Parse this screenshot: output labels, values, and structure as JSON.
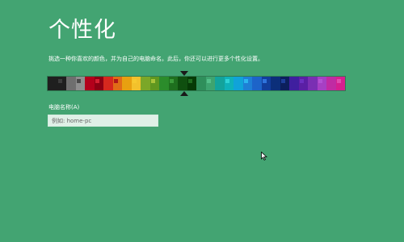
{
  "page": {
    "title": "个性化",
    "instruction": "挑选一种你喜欢的颜色，并为自己的电脑命名。此后，你还可以进行更多个性化设置。"
  },
  "colors": {
    "background": "#43a472",
    "text": "#ffffff"
  },
  "palette": {
    "selected_index": 8,
    "swatches": [
      {
        "left": "#1f1f1f",
        "right": "#1f1f1f",
        "chip": "#3c3c3c"
      },
      {
        "left": "#6f6f6f",
        "right": "#8f8f8f",
        "chip": "#4a4a4a"
      },
      {
        "left": "#b3001b",
        "right": "#8d0013",
        "chip": "#d41f32"
      },
      {
        "left": "#d5281e",
        "right": "#e06c17",
        "chip": "#b01618"
      },
      {
        "left": "#e8a010",
        "right": "#f3c12c",
        "chip": "#f7c92f"
      },
      {
        "left": "#7ba728",
        "right": "#5f9720",
        "chip": "#a8c43a"
      },
      {
        "left": "#2b8c2b",
        "right": "#1e6f1e",
        "chip": "#3a9b3a"
      },
      {
        "left": "#0f4f0f",
        "right": "#063a06",
        "chip": "#1f6b1f"
      },
      {
        "left": "#2f8f5b",
        "right": "#3ea46f",
        "chip": "#55c08a"
      },
      {
        "left": "#13a39b",
        "right": "#0fb1b9",
        "chip": "#2fd3d5"
      },
      {
        "left": "#10a3d9",
        "right": "#1e7fd5",
        "chip": "#2bb5f0"
      },
      {
        "left": "#1d64c9",
        "right": "#123e9c",
        "chip": "#2f74dc"
      },
      {
        "left": "#0c2f7a",
        "right": "#0c1f5c",
        "chip": "#1d3f9a"
      },
      {
        "left": "#3f1f9f",
        "right": "#5a1fa4",
        "chip": "#6a2fc0"
      },
      {
        "left": "#7a2fb3",
        "right": "#a640c4",
        "chip": "#b352d4"
      },
      {
        "left": "#c02ba3",
        "right": "#d61f8f",
        "chip": "#e04db0"
      }
    ]
  },
  "computer_name": {
    "label": "电脑名称(A)",
    "value": "",
    "placeholder": "例如: home-pc"
  },
  "icons": {
    "selector_top": "selector-arrow-down-icon",
    "selector_bottom": "selector-arrow-up-icon",
    "cursor": "mouse-cursor-icon"
  }
}
